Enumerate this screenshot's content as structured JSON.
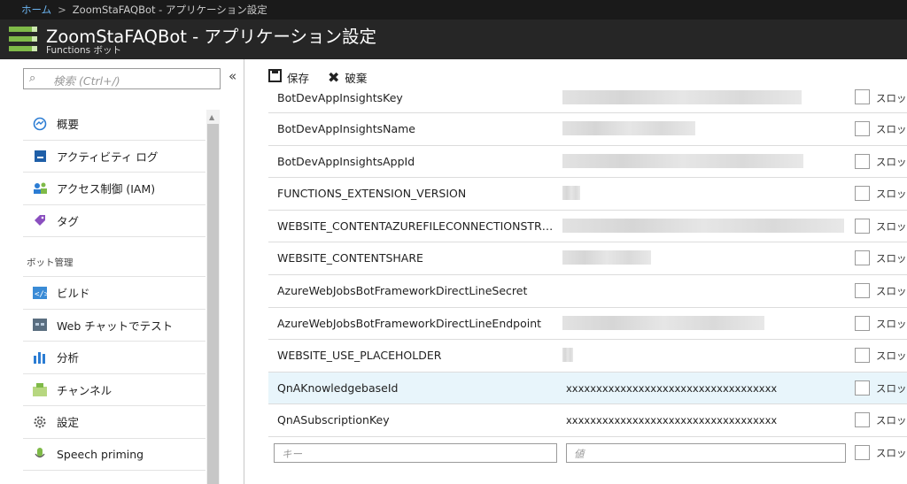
{
  "breadcrumb": {
    "home": "ホーム",
    "current": "ZoomStaFAQBot - アプリケーション設定"
  },
  "blade": {
    "title": "ZoomStaFAQBot - アプリケーション設定",
    "subtitle": "Functions ボット"
  },
  "search": {
    "placeholder": "検索 (Ctrl+/)"
  },
  "nav": {
    "collapse": "«",
    "items_top": [
      {
        "label": "概要",
        "icon": "overview-icon"
      },
      {
        "label": "アクティビティ ログ",
        "icon": "activity-log-icon"
      },
      {
        "label": "アクセス制御 (IAM)",
        "icon": "iam-icon"
      },
      {
        "label": "タグ",
        "icon": "tag-icon"
      }
    ],
    "section": "ボット管理",
    "items_bot": [
      {
        "label": "ビルド",
        "icon": "build-icon"
      },
      {
        "label": "Web チャットでテスト",
        "icon": "webchat-icon"
      },
      {
        "label": "分析",
        "icon": "analytics-icon"
      },
      {
        "label": "チャンネル",
        "icon": "channels-icon"
      },
      {
        "label": "設定",
        "icon": "settings-icon"
      },
      {
        "label": "Speech priming",
        "icon": "speech-icon"
      }
    ]
  },
  "toolbar": {
    "save": "保存",
    "discard": "破棄"
  },
  "slot_label": "スロット",
  "settings": [
    {
      "key": "BotDevAppInsightsKey",
      "value": "",
      "obscured": true
    },
    {
      "key": "BotDevAppInsightsName",
      "value": "",
      "obscured": true
    },
    {
      "key": "BotDevAppInsightsAppId",
      "value": "",
      "obscured": true
    },
    {
      "key": "FUNCTIONS_EXTENSION_VERSION",
      "value": "",
      "obscured": true
    },
    {
      "key": "WEBSITE_CONTENTAZUREFILECONNECTIONSTR…",
      "value": "",
      "obscured": true
    },
    {
      "key": "WEBSITE_CONTENTSHARE",
      "value": "",
      "obscured": true
    },
    {
      "key": "AzureWebJobsBotFrameworkDirectLineSecret",
      "value": "",
      "obscured": false
    },
    {
      "key": "AzureWebJobsBotFrameworkDirectLineEndpoint",
      "value": "",
      "obscured": true
    },
    {
      "key": "WEBSITE_USE_PLACEHOLDER",
      "value": "",
      "obscured": true
    },
    {
      "key": "QnAKnowledgebaseId",
      "value": "xxxxxxxxxxxxxxxxxxxxxxxxxxxxxxxxxxx",
      "obscured": false,
      "selected": true
    },
    {
      "key": "QnASubscriptionKey",
      "value": "xxxxxxxxxxxxxxxxxxxxxxxxxxxxxxxxxxx",
      "obscured": false
    }
  ],
  "new_row": {
    "key_placeholder": "キー",
    "value_placeholder": "値"
  },
  "colors": {
    "accent": "#7fba48",
    "link": "#6cb4f0",
    "selected_row": "#e8f5fb",
    "header_bg": "#262626"
  }
}
